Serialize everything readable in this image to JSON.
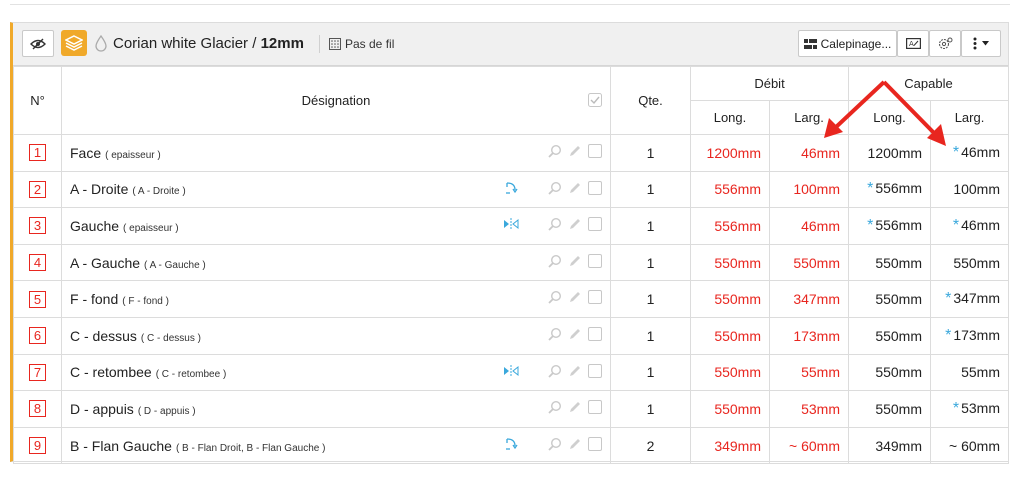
{
  "toolbar": {
    "material_name": "Corian white Glacier / ",
    "material_thickness": "12mm",
    "grain_label": "Pas de fil",
    "calepinage_label": "Calepinage...",
    "icons": [
      "eye-off-icon",
      "layers-icon",
      "drop-icon",
      "grain-icon",
      "layout-icon",
      "label-icon",
      "settings-icon",
      "more-icon"
    ]
  },
  "headers": {
    "num": "N°",
    "designation": "Désignation",
    "qte": "Qte.",
    "debit": "Débit",
    "capable": "Capable",
    "long": "Long.",
    "larg": "Larg."
  },
  "rows": [
    {
      "n": "1",
      "name": "Face",
      "sub": "( epaisseur )",
      "op": "",
      "qte": "1",
      "debit_long": "1200mm",
      "debit_larg": "46mm",
      "cap_long": "1200mm",
      "cap_long_star": false,
      "cap_larg": "46mm",
      "cap_larg_star": true
    },
    {
      "n": "2",
      "name": "A - Droite",
      "sub": "( A - Droite )",
      "op": "rotate",
      "qte": "1",
      "debit_long": "556mm",
      "debit_larg": "100mm",
      "cap_long": "556mm",
      "cap_long_star": true,
      "cap_larg": "100mm",
      "cap_larg_star": false
    },
    {
      "n": "3",
      "name": "Gauche",
      "sub": "( epaisseur )",
      "op": "mirror",
      "qte": "1",
      "debit_long": "556mm",
      "debit_larg": "46mm",
      "cap_long": "556mm",
      "cap_long_star": true,
      "cap_larg": "46mm",
      "cap_larg_star": true
    },
    {
      "n": "4",
      "name": "A - Gauche",
      "sub": "( A - Gauche )",
      "op": "",
      "qte": "1",
      "debit_long": "550mm",
      "debit_larg": "550mm",
      "cap_long": "550mm",
      "cap_long_star": false,
      "cap_larg": "550mm",
      "cap_larg_star": false
    },
    {
      "n": "5",
      "name": "F - fond",
      "sub": "( F - fond )",
      "op": "",
      "qte": "1",
      "debit_long": "550mm",
      "debit_larg": "347mm",
      "cap_long": "550mm",
      "cap_long_star": false,
      "cap_larg": "347mm",
      "cap_larg_star": true
    },
    {
      "n": "6",
      "name": "C - dessus",
      "sub": "( C - dessus )",
      "op": "",
      "qte": "1",
      "debit_long": "550mm",
      "debit_larg": "173mm",
      "cap_long": "550mm",
      "cap_long_star": false,
      "cap_larg": "173mm",
      "cap_larg_star": true
    },
    {
      "n": "7",
      "name": "C - retombee",
      "sub": "( C - retombee )",
      "op": "mirror",
      "qte": "1",
      "debit_long": "550mm",
      "debit_larg": "55mm",
      "cap_long": "550mm",
      "cap_long_star": false,
      "cap_larg": "55mm",
      "cap_larg_star": false
    },
    {
      "n": "8",
      "name": "D - appuis",
      "sub": "( D - appuis )",
      "op": "",
      "qte": "1",
      "debit_long": "550mm",
      "debit_larg": "53mm",
      "cap_long": "550mm",
      "cap_long_star": false,
      "cap_larg": "53mm",
      "cap_larg_star": true
    },
    {
      "n": "9",
      "name": "B - Flan Gauche",
      "sub": "( B - Flan Droit, B - Flan Gauche )",
      "op": "rotate",
      "qte": "2",
      "debit_long": "349mm",
      "debit_larg": "~ 60mm",
      "cap_long": "349mm",
      "cap_long_star": false,
      "cap_larg": "~ 60mm",
      "cap_larg_star": false
    }
  ],
  "colors": {
    "accent": "#f0a92a",
    "red": "#e8261f",
    "blue": "#3aa8dc"
  }
}
